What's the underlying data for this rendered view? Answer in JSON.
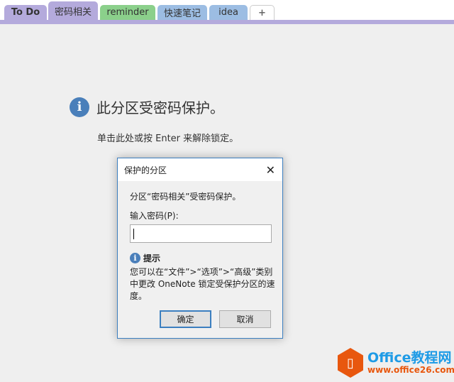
{
  "tabs": [
    {
      "label": "To Do",
      "color": "#b4aadc"
    },
    {
      "label": "密码相关",
      "color": "#b4aadc"
    },
    {
      "label": "reminder",
      "color": "#8bd08b"
    },
    {
      "label": "快速笔记",
      "color": "#9cbde3"
    },
    {
      "label": "idea",
      "color": "#9cbde3"
    },
    {
      "label": "+",
      "color": "#ffffff"
    }
  ],
  "main": {
    "title": "此分区受密码保护。",
    "subtitle": "单击此处或按 Enter 来解除锁定。"
  },
  "dialog": {
    "title": "保护的分区",
    "message": "分区“密码相关”受密码保护。",
    "password_label": "输入密码(P):",
    "password_value": "",
    "hint_title": "提示",
    "hint_text": "您可以在“文件”>“选项”>“高级”类别中更改 OneNote 锁定受保护分区的速度。",
    "ok": "确定",
    "cancel": "取消"
  },
  "watermark": {
    "line1": "Office教程网",
    "line2": "www.office26.com"
  }
}
